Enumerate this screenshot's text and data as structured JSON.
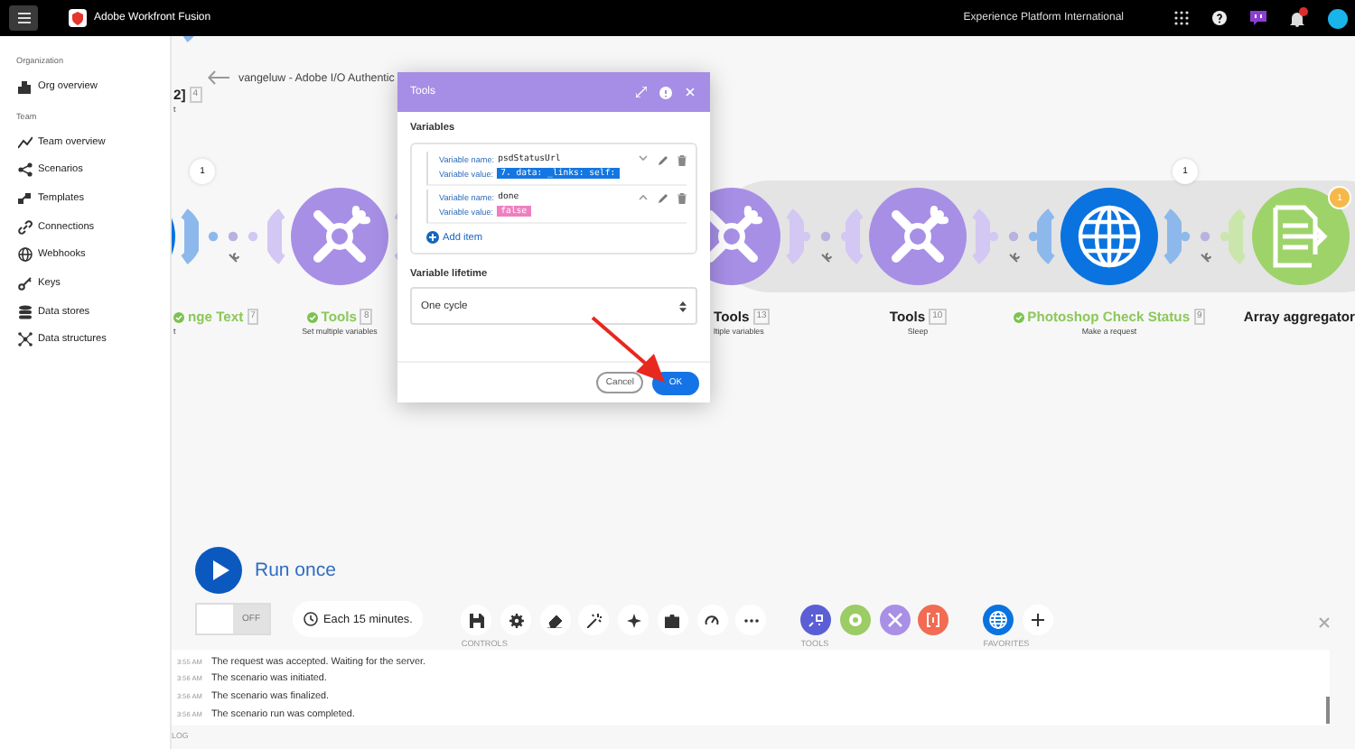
{
  "top_bar": {
    "app_name": "Adobe Workfront Fusion",
    "org_name": "Experience Platform International"
  },
  "sidebar": {
    "sections": [
      {
        "title": "Organization",
        "items": [
          {
            "label": "Org overview"
          }
        ]
      },
      {
        "title": "Team",
        "items": [
          {
            "label": "Team overview"
          },
          {
            "label": "Scenarios"
          },
          {
            "label": "Templates"
          },
          {
            "label": "Connections"
          },
          {
            "label": "Webhooks"
          },
          {
            "label": "Keys"
          },
          {
            "label": "Data stores"
          },
          {
            "label": "Data structures"
          }
        ]
      }
    ]
  },
  "scenario": {
    "title": "vangeluw - Adobe I/O Authentic",
    "nodes": [
      {
        "kind": "http",
        "title": "2]",
        "number": "4",
        "subtitle": "t",
        "ok": false
      },
      {
        "kind": "http",
        "title": "nge Text",
        "number": "7",
        "subtitle": "t",
        "ok": true,
        "bubble": "1"
      },
      {
        "kind": "tools",
        "title": "Tools",
        "number": "8",
        "subtitle": "Set multiple variables",
        "ok": true
      },
      {
        "kind": "tools",
        "title": "Tools",
        "number": "13",
        "subtitle": "ltiple variables",
        "ok": false
      },
      {
        "kind": "tools",
        "title": "Tools",
        "number": "10",
        "subtitle": "Sleep",
        "ok": false
      },
      {
        "kind": "http",
        "title": "Photoshop Check Status",
        "number": "9",
        "subtitle": "Make a request",
        "ok": true,
        "bubble": "1"
      },
      {
        "kind": "aggregator",
        "title": "Array aggregator",
        "ok": false,
        "badge": "1"
      }
    ]
  },
  "dialog": {
    "title": "Tools",
    "section": "Variables",
    "items": [
      {
        "name_label": "Variable name:",
        "name": "psdStatusUrl",
        "value_label": "Variable value:",
        "value": "7. data: _links: self:",
        "kind": "mapped",
        "expanded": false
      },
      {
        "name_label": "Variable name:",
        "name": "done",
        "value_label": "Variable value:",
        "value": "false",
        "kind": "keyword",
        "expanded": true
      }
    ],
    "add_label": "Add item",
    "lifetime_label": "Variable lifetime",
    "lifetime": "One cycle",
    "buttons": [
      {
        "label": "Cancel",
        "primary": false
      },
      {
        "label": "OK",
        "primary": true
      }
    ]
  },
  "run_label": "Run once",
  "schedule": {
    "on": false,
    "label": "OFF",
    "interval": "Each 15 minutes."
  },
  "toolbar": {
    "controls_label": "CONTROLS",
    "tools_label": "TOOLS",
    "tools": [
      {
        "color": "#5b5fd6"
      },
      {
        "color": "#9ccc65"
      },
      {
        "color": "#a98fe6"
      },
      {
        "color": "#f26b52"
      }
    ],
    "favorites_label": "FAVORITES",
    "favorites": [
      {
        "color": "#0a73e0"
      }
    ]
  },
  "log": {
    "label": "LOG",
    "entries": [
      {
        "time": "3:55 AM",
        "text": "The request was accepted. Waiting for the server."
      },
      {
        "time": "3:56 AM",
        "text": "The scenario was initiated."
      },
      {
        "time": "3:56 AM",
        "text": "The scenario was finalized."
      },
      {
        "time": "3:56 AM",
        "text": "The scenario run was completed."
      }
    ]
  }
}
